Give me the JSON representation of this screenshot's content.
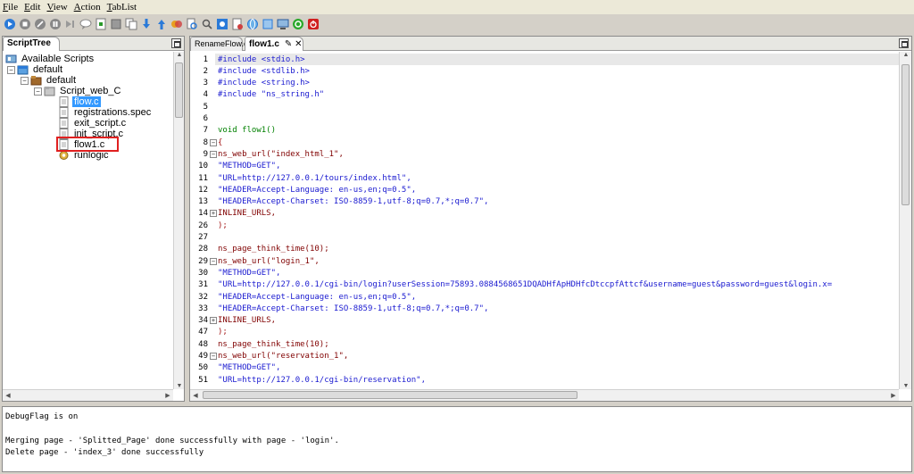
{
  "menu": [
    "File",
    "Edit",
    "View",
    "Action",
    "TabList"
  ],
  "toolbar": [
    "run-icon",
    "stop-icon",
    "cancel-icon",
    "pause-icon",
    "step-icon",
    "comment-icon",
    "add-page-icon",
    "stop-square-icon",
    "copy-icon",
    "download-icon",
    "upload-icon",
    "transaction-icon",
    "find-icon",
    "replace-icon",
    "settings-icon",
    "doc-check-icon",
    "globe-icon",
    "report-icon",
    "monitor-icon",
    "refresh-icon",
    "power-icon"
  ],
  "left_panel": {
    "tab": "ScriptTree",
    "tree": [
      {
        "label": "Available Scripts",
        "icon": "scripts-icon"
      },
      {
        "label": "default",
        "icon": "project-icon"
      },
      {
        "label": "default",
        "icon": "folder-icon"
      },
      {
        "label": "Script_web_C",
        "icon": "script-icon"
      },
      {
        "label": "flow.c",
        "icon": "file-icon",
        "selected": true
      },
      {
        "label": "registrations.spec",
        "icon": "file-icon"
      },
      {
        "label": "exit_script.c",
        "icon": "file-icon"
      },
      {
        "label": "init_script.c",
        "icon": "file-icon"
      },
      {
        "label": "flow1.c",
        "icon": "file-icon",
        "highlighted": true
      },
      {
        "label": "runlogic",
        "icon": "gear-icon"
      }
    ]
  },
  "editor": {
    "tabs": [
      {
        "label": "RenameFlow.c",
        "active": false
      },
      {
        "label": "flow1.c",
        "active": true,
        "modified_marker": "✎ ✕"
      }
    ],
    "lines": [
      {
        "n": "1",
        "fold": "",
        "text": "#include <stdio.h>",
        "style": "c-pp"
      },
      {
        "n": "2",
        "fold": "",
        "text": "#include <stdlib.h>",
        "style": "c-pp"
      },
      {
        "n": "3",
        "fold": "",
        "text": "#include <string.h>",
        "style": "c-pp"
      },
      {
        "n": "4",
        "fold": "",
        "text": "#include \"ns_string.h\"",
        "style": "c-pp"
      },
      {
        "n": "5",
        "fold": "",
        "text": "",
        "style": "c-plain"
      },
      {
        "n": "6",
        "fold": "",
        "text": "",
        "style": "c-plain"
      },
      {
        "n": "7",
        "fold": "",
        "text": "void flow1()",
        "style": "c-kw"
      },
      {
        "n": "8",
        "fold": "−",
        "text": "{",
        "style": "c-fn"
      },
      {
        "n": "9",
        "fold": "−",
        "text": "ns_web_url(\"index_html_1\",",
        "style": "c-id"
      },
      {
        "n": "10",
        "fold": "",
        "text": "\"METHOD=GET\",",
        "style": "c-str"
      },
      {
        "n": "11",
        "fold": "",
        "text": "\"URL=http://127.0.0.1/tours/index.html\",",
        "style": "c-str"
      },
      {
        "n": "12",
        "fold": "",
        "text": "\"HEADER=Accept-Language: en-us,en;q=0.5\",",
        "style": "c-str"
      },
      {
        "n": "13",
        "fold": "",
        "text": "\"HEADER=Accept-Charset: ISO-8859-1,utf-8;q=0.7,*;q=0.7\",",
        "style": "c-str"
      },
      {
        "n": "14",
        "fold": "+",
        "text": "INLINE_URLS,",
        "style": "c-id"
      },
      {
        "n": "26",
        "fold": "",
        "text": ");",
        "style": "c-fn"
      },
      {
        "n": "27",
        "fold": "",
        "text": "",
        "style": "c-plain"
      },
      {
        "n": "28",
        "fold": "",
        "text": "ns_page_think_time(10);",
        "style": "c-id"
      },
      {
        "n": "29",
        "fold": "−",
        "text": "ns_web_url(\"login_1\",",
        "style": "c-id"
      },
      {
        "n": "30",
        "fold": "",
        "text": "\"METHOD=GET\",",
        "style": "c-str"
      },
      {
        "n": "31",
        "fold": "",
        "text": "\"URL=http://127.0.0.1/cgi-bin/login?userSession=75893.0884568651DQADHfApHDHfcDtccpfAttcf&username=guest&password=guest&login.x=",
        "style": "c-str"
      },
      {
        "n": "32",
        "fold": "",
        "text": "\"HEADER=Accept-Language: en-us,en;q=0.5\",",
        "style": "c-str"
      },
      {
        "n": "33",
        "fold": "",
        "text": "\"HEADER=Accept-Charset: ISO-8859-1,utf-8;q=0.7,*;q=0.7\",",
        "style": "c-str"
      },
      {
        "n": "34",
        "fold": "+",
        "text": "INLINE_URLS,",
        "style": "c-id"
      },
      {
        "n": "47",
        "fold": "",
        "text": ");",
        "style": "c-fn"
      },
      {
        "n": "48",
        "fold": "",
        "text": "ns_page_think_time(10);",
        "style": "c-id"
      },
      {
        "n": "49",
        "fold": "−",
        "text": "ns_web_url(\"reservation_1\",",
        "style": "c-id"
      },
      {
        "n": "50",
        "fold": "",
        "text": "\"METHOD=GET\",",
        "style": "c-str"
      },
      {
        "n": "51",
        "fold": "",
        "text": "\"URL=http://127.0.0.1/cgi-bin/reservation\",",
        "style": "c-str"
      }
    ]
  },
  "console": [
    "DebugFlag is on",
    "",
    "Merging page - 'Splitted_Page' done successfully with page - 'login'.",
    "Delete page - 'index_3' done successfully"
  ]
}
